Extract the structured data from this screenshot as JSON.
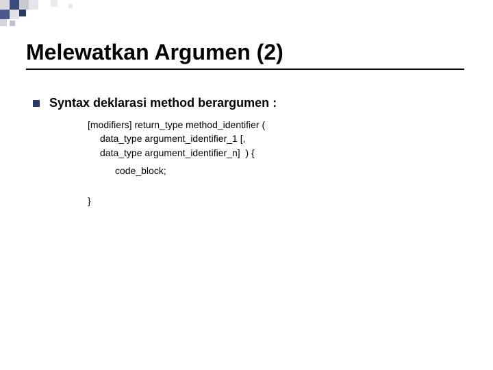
{
  "title": "Melewatkan Argumen (2)",
  "subtitle": "Syntax deklarasi method berargumen :",
  "code": {
    "l1": "[modifiers] return_type method_identifier (",
    "l2": "data_type argument_identifier_1 [,",
    "l3": "data_type argument_identifier_n]  ) {",
    "l4": "code_block;",
    "l5": "}"
  }
}
